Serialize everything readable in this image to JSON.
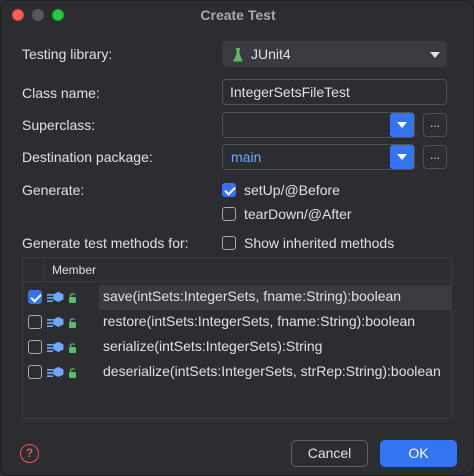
{
  "window": {
    "title": "Create Test"
  },
  "form": {
    "testing_library": {
      "label": "Testing library:",
      "value": "JUnit4"
    },
    "class_name": {
      "label": "Class name:",
      "value": "IntegerSetsFileTest"
    },
    "superclass": {
      "label": "Superclass:",
      "value": "",
      "browse_label": "..."
    },
    "destination_package": {
      "label": "Destination package:",
      "value": "main",
      "browse_label": "..."
    },
    "generate": {
      "label": "Generate:",
      "options": [
        {
          "label": "setUp/@Before",
          "checked": true
        },
        {
          "label": "tearDown/@After",
          "checked": false
        }
      ]
    },
    "generate_methods_for": {
      "label": "Generate test methods for:",
      "show_inherited": {
        "label": "Show inherited methods",
        "checked": false
      }
    }
  },
  "members_table": {
    "column_header": "Member",
    "rows": [
      {
        "signature": "save(intSets:IntegerSets, fname:String):boolean",
        "checked": true,
        "selected": true
      },
      {
        "signature": "restore(intSets:IntegerSets, fname:String):boolean",
        "checked": false,
        "selected": false
      },
      {
        "signature": "serialize(intSets:IntegerSets):String",
        "checked": false,
        "selected": false
      },
      {
        "signature": "deserialize(intSets:IntegerSets, strRep:String):boolean",
        "checked": false,
        "selected": false
      }
    ]
  },
  "footer": {
    "help_label": "?",
    "cancel_label": "Cancel",
    "ok_label": "OK"
  },
  "colors": {
    "accent": "#3574f0",
    "background": "#2b2d30",
    "help": "#e55765",
    "package_text": "#6fa8ff"
  }
}
